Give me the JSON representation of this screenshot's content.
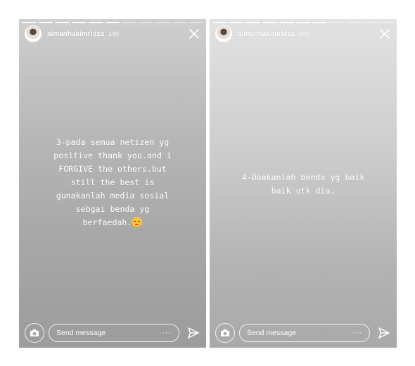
{
  "stories": [
    {
      "username": "aimanhakimridza",
      "time": "14h",
      "progress_filled": 6,
      "progress_total": 11,
      "caption": "3-pada semua netizen yg\npositive thank you.and i\nFORGIVE the others.but\nstill the best is\ngunakanlah media sosial\nsebgai benda yg\nberfaedah.",
      "caption_emoji": "pensive-face-emoji",
      "message_placeholder": "Send message",
      "more_label": "···"
    },
    {
      "username": "aimanhakimridza",
      "time": "14h",
      "progress_filled": 7,
      "progress_total": 11,
      "caption": "4-Doakanlah benda yg baik\nbaik utk dia.",
      "message_placeholder": "Send message",
      "more_label": "···"
    }
  ],
  "icons": {
    "close": "close-icon",
    "camera": "camera-icon",
    "send": "send-icon"
  }
}
